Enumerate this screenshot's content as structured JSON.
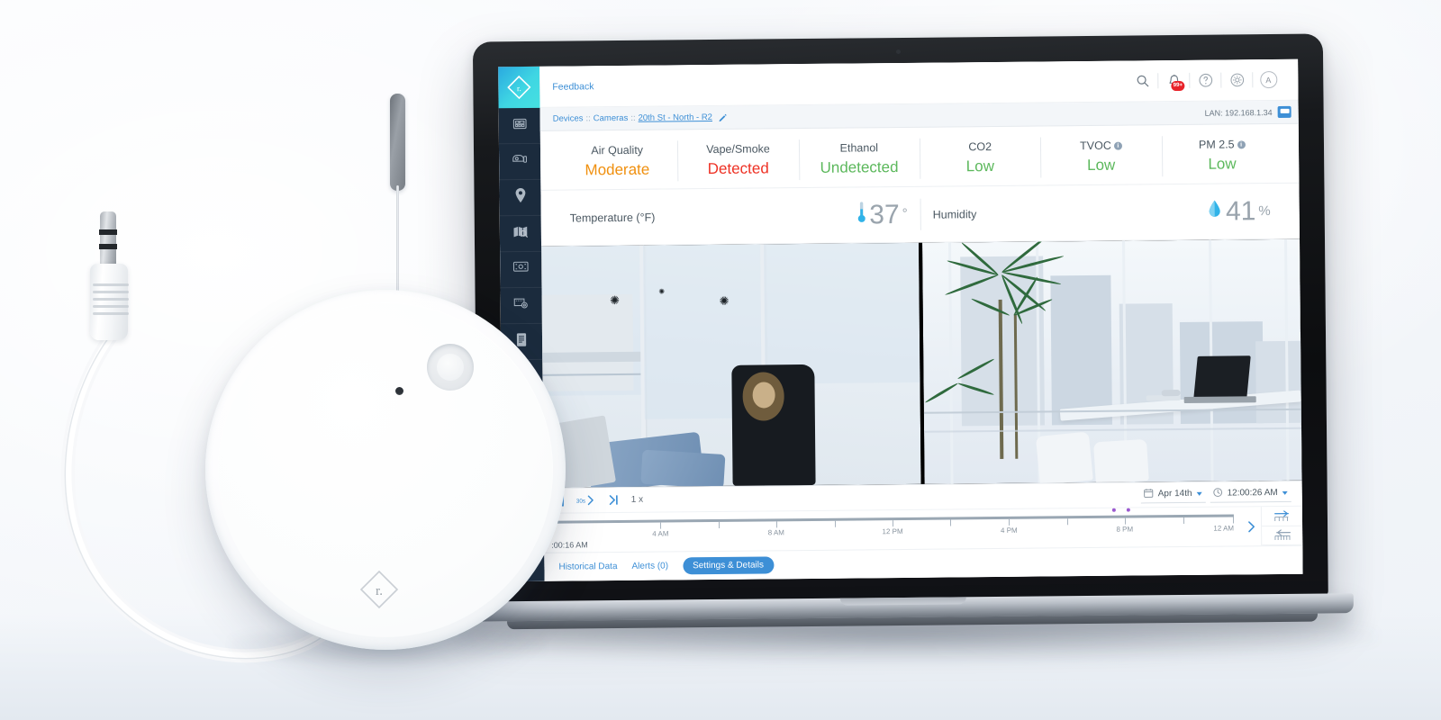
{
  "app": {
    "topbar": {
      "feedback_label": "Feedback",
      "icons": [
        {
          "name": "search-icon",
          "glyph": "search"
        },
        {
          "name": "notification-bell-icon",
          "glyph": "bell",
          "badge": "99+"
        },
        {
          "name": "help-icon",
          "glyph": "question"
        },
        {
          "name": "settings-gear-icon",
          "glyph": "gear"
        },
        {
          "name": "user-avatar",
          "glyph": "A"
        }
      ]
    },
    "breadcrumb": {
      "root": "Devices",
      "sep": "::",
      "section": "Cameras",
      "current": "20th St - North - R2",
      "edit_icon": "pencil-icon",
      "lan_label": "LAN: 192.168.1.34",
      "lan_icon": "network-device-icon"
    },
    "sidebar": {
      "logo_name": "rhombus-logo",
      "items": [
        {
          "name": "sidebar-item-dashboard",
          "icon": "dashboard-icon"
        },
        {
          "name": "sidebar-item-cameras",
          "icon": "camera-icon"
        },
        {
          "name": "sidebar-item-locations",
          "icon": "map-pin-icon"
        },
        {
          "name": "sidebar-item-floorplans",
          "icon": "map-search-icon"
        },
        {
          "name": "sidebar-item-video-wall",
          "icon": "video-wall-icon"
        },
        {
          "name": "sidebar-item-devices",
          "icon": "sensor-device-icon"
        },
        {
          "name": "sidebar-item-reports",
          "icon": "document-icon"
        }
      ]
    },
    "sensors": [
      {
        "label": "Air Quality",
        "value": "Moderate",
        "state": "moderate",
        "info": false
      },
      {
        "label": "Vape/Smoke",
        "value": "Detected",
        "state": "detected",
        "info": false
      },
      {
        "label": "Ethanol",
        "value": "Undetected",
        "state": "ok",
        "info": false
      },
      {
        "label": "CO2",
        "value": "Low",
        "state": "ok",
        "info": false
      },
      {
        "label": "TVOC",
        "value": "Low",
        "state": "ok",
        "info": true
      },
      {
        "label": "PM 2.5",
        "value": "Low",
        "state": "ok",
        "info": true
      }
    ],
    "climate": [
      {
        "label": "Temperature (°F)",
        "value": "37",
        "unit": "°",
        "icon": "thermometer-icon"
      },
      {
        "label": "Humidity",
        "value": "41",
        "unit": "%",
        "icon": "water-drop-icon"
      }
    ],
    "video": {
      "cameras": [
        {
          "name": "camera-feed-left",
          "scene": "two people seated by window, vaping"
        },
        {
          "name": "camera-feed-right",
          "scene": "office lounge with palm plant, desk and laptop by window"
        }
      ]
    },
    "playback": {
      "pause_label": "pause",
      "skip_label": "30s",
      "jump_end_label": "jump-to-live",
      "speed": "1 x",
      "date_value": "Apr 14th",
      "time_value": "12:00:26 AM",
      "calendar_icon": "calendar-icon",
      "clock_icon": "clock-icon"
    },
    "timeline": {
      "current_time": ":00:16 AM",
      "ticks": [
        {
          "label": "",
          "pct": 0
        },
        {
          "label": "4 AM",
          "pct": 16.7
        },
        {
          "label": "8 AM",
          "pct": 33.3
        },
        {
          "label": "12 PM",
          "pct": 50
        },
        {
          "label": "4 PM",
          "pct": 66.7
        },
        {
          "label": "8 PM",
          "pct": 83.3
        },
        {
          "label": "12 AM",
          "pct": 100
        }
      ],
      "events": [
        {
          "pct": 81.5
        },
        {
          "pct": 83.6
        }
      ],
      "next_icon": "chevron-right-icon",
      "zoom_in_icon": "timeline-zoom-in-icon",
      "zoom_out_icon": "timeline-zoom-out-icon"
    },
    "tabs": [
      {
        "label": "Historical Data",
        "active": false
      },
      {
        "label": "Alerts (0)",
        "active": false
      },
      {
        "label": "Settings & Details",
        "active": true
      }
    ]
  },
  "product": {
    "puck_name": "environmental-sensor-puck",
    "logo_glyph": "r.",
    "probe_name": "sensor-probe-antenna",
    "cable_name": "sensor-cable",
    "jack_name": "audio-jack-connector"
  },
  "colors": {
    "accent": "#3d8fd6",
    "sidebar": "#1b2b3d",
    "logo_start": "#2aa9e0",
    "logo_end": "#46e0e0",
    "moderate": "#f0900f",
    "detected": "#ee3124",
    "ok": "#5cb85c",
    "badge": "#e8232a",
    "event_marker": "#9b59d0"
  }
}
